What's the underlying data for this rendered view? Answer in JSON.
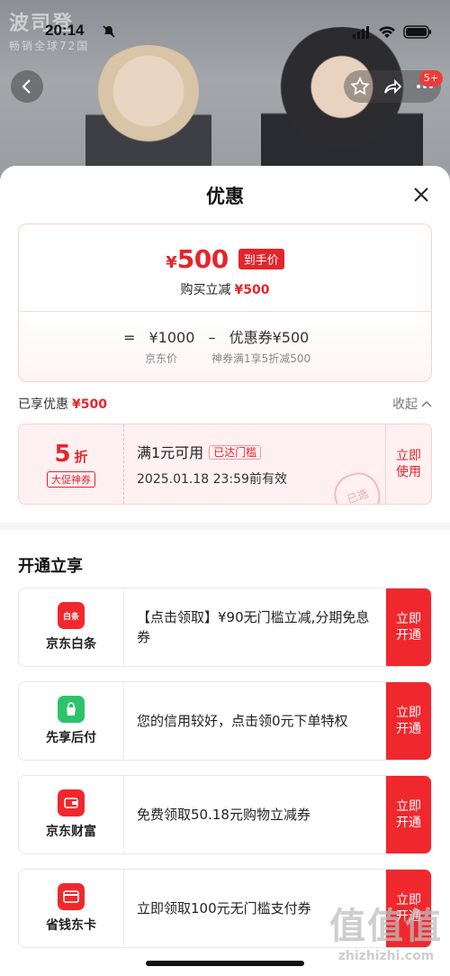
{
  "status_bar": {
    "time": "20:14"
  },
  "hero": {
    "brand_name": "波司登",
    "brand_sub": "畅销全球72国",
    "cart_badge": "5+"
  },
  "sheet": {
    "title": "优惠"
  },
  "price_card": {
    "currency": "¥",
    "final_price": "500",
    "final_tag": "到手价",
    "instant_label": "购买立减",
    "instant_amount": "¥500",
    "formula": {
      "eq": "=",
      "jd_price": "¥1000",
      "minus": "–",
      "coupon_label": "优惠券¥500"
    },
    "jd_price_label": "京东价",
    "coupon_desc": "神券满1享5折减500"
  },
  "enjoyed": {
    "label": "已享优惠",
    "amount": "¥500",
    "collapse": "收起"
  },
  "coupon": {
    "discount": "5",
    "unit": "折",
    "type": "大促神券",
    "condition": "满1元可用",
    "reached": "已达门槛",
    "expiry": "2025.01.18 23:59前有效",
    "stamp": "已选",
    "use_label": "立即使用"
  },
  "section2": {
    "title": "开通立享",
    "items": [
      {
        "name": "京东白条",
        "icon_label": "白条",
        "desc": "【点击领取】¥90无门槛立减,分期免息券",
        "btn": "立即开通",
        "icon_color": "#f0282e"
      },
      {
        "name": "先享后付",
        "icon_label": "",
        "desc": "您的信用较好，点击领0元下单特权",
        "btn": "立即开通",
        "icon_color": "#2cc36b"
      },
      {
        "name": "京东财富",
        "icon_label": "",
        "desc": "免费领取50.18元购物立减券",
        "btn": "立即开通",
        "icon_color": "#f0282e"
      },
      {
        "name": "省钱东卡",
        "icon_label": "",
        "desc": "立即领取100元无门槛支付券",
        "btn": "立即开通",
        "icon_color": "#f0282e"
      }
    ]
  },
  "watermark": {
    "big": "值值值",
    "small": "zhizhizhi.com"
  }
}
